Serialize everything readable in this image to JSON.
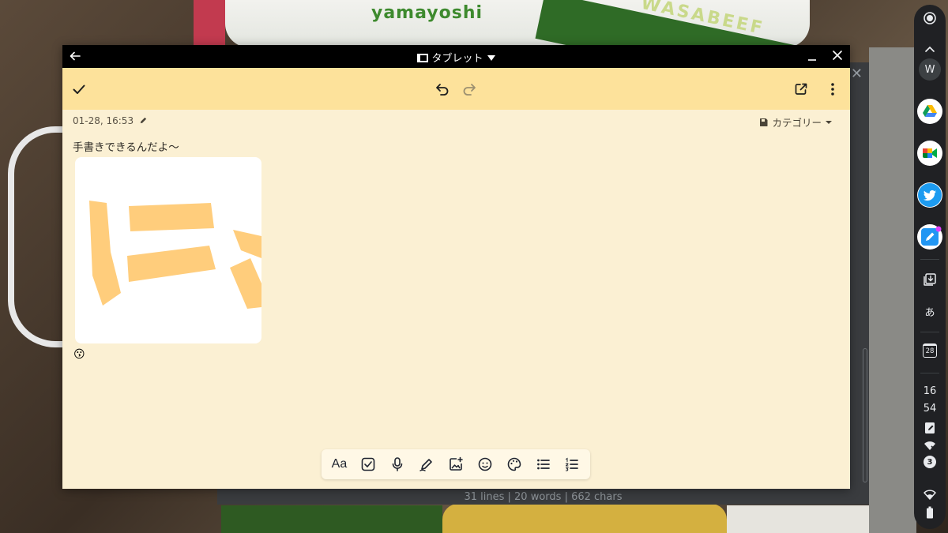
{
  "wallpaper": {
    "bag_text": "yamayoshi",
    "stripe_text": "WASABEEF"
  },
  "back_window": {
    "close_label": "✕",
    "status": "31 lines | 20 words | 662 chars"
  },
  "window": {
    "title": "タブレット"
  },
  "note": {
    "date": "01-28, 16:53",
    "category_label": "カテゴリー",
    "text": "手書きできるんだよ〜",
    "emoji": "😗"
  },
  "format_bar": {
    "font_label": "Aa"
  },
  "shelf": {
    "avatar_letter": "W",
    "ime_label": "あ",
    "calendar_day": "28",
    "clock_hour": "16",
    "clock_minute": "54",
    "notification_count": "3"
  },
  "colors": {
    "toolbar": "#fde29b",
    "note_background": "#fbf0d3",
    "drawing_stroke": "#ffc971",
    "titlebar": "#000000",
    "shelf": "#202124"
  }
}
